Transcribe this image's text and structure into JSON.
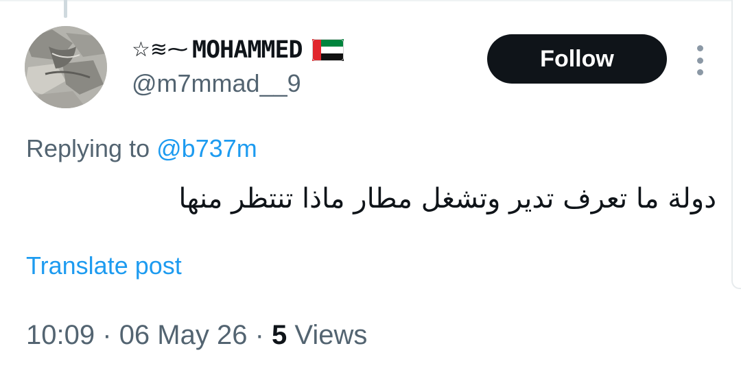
{
  "author": {
    "name_decoration": "☆≋⁓",
    "display_name": "MOHAMMED",
    "flag": "uae-flag-emoji",
    "handle": "@m7mmad__9"
  },
  "actions": {
    "follow_label": "Follow",
    "more_icon": "more-vertical-icon"
  },
  "reply": {
    "prefix": "Replying to",
    "mention": "@b737m"
  },
  "post": {
    "text": "دولة ما تعرف تدير وتشغل مطار ماذا تنتظر منها",
    "translate_label": "Translate post"
  },
  "meta": {
    "time": "10:09",
    "separator": "·",
    "date": "06 May 26",
    "views_count": "5",
    "views_label": "Views"
  },
  "colors": {
    "text": "#0f1419",
    "secondary": "#536471",
    "accent": "#1d9bf0",
    "button_bg": "#0f1419",
    "button_text": "#ffffff"
  }
}
